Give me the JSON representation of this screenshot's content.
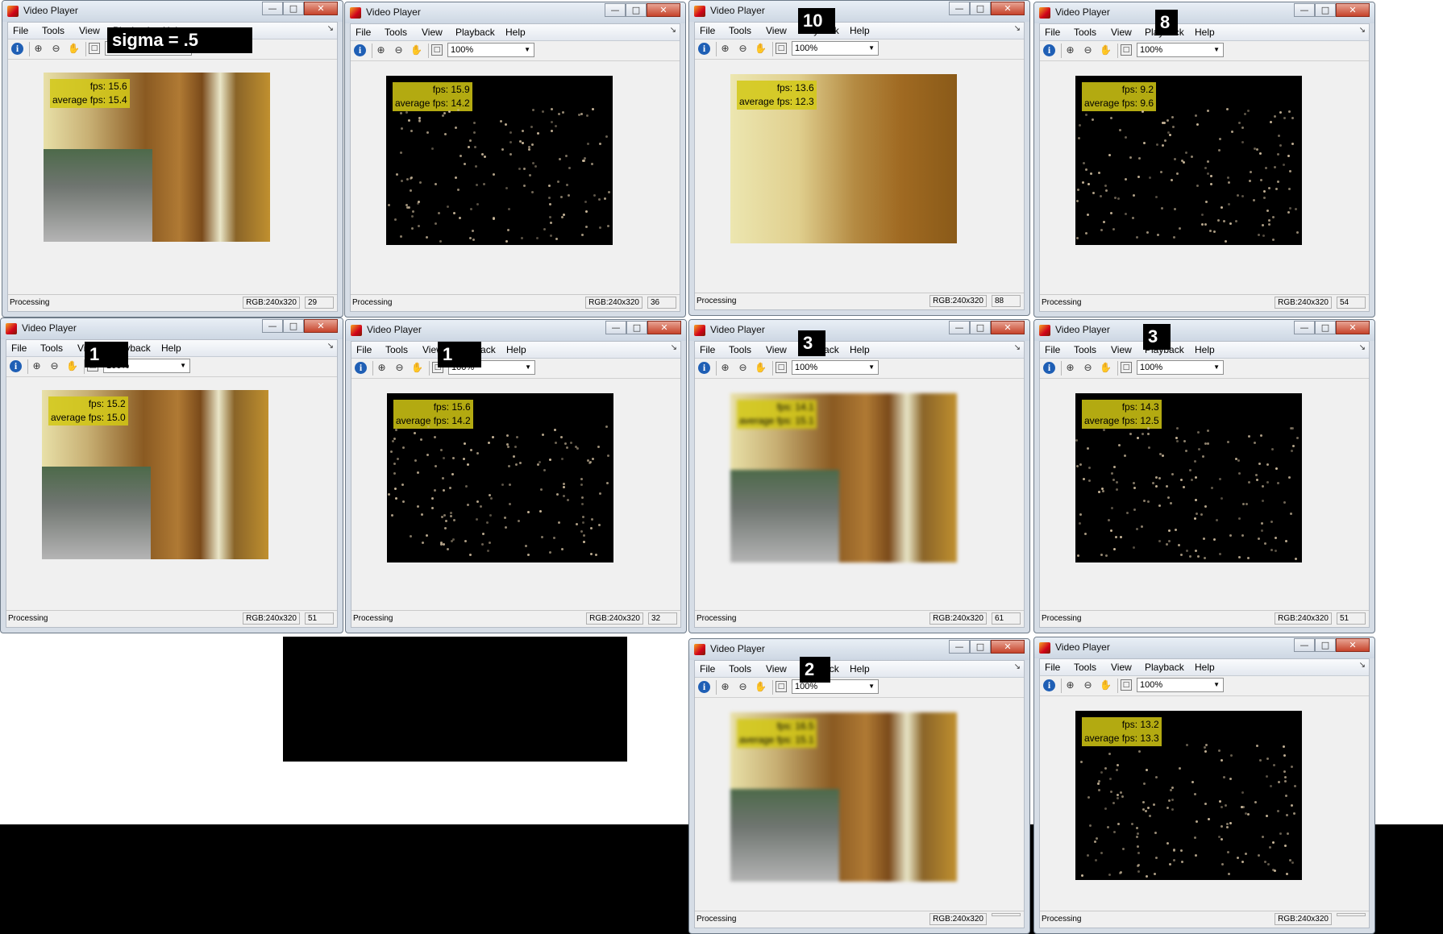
{
  "window": {
    "title": "Video Player",
    "menu": {
      "file": "File",
      "tools": "Tools",
      "view": "View",
      "playback": "Playback",
      "help": "Help"
    },
    "zoom": "100%",
    "status": "Processing",
    "resolution": "RGB:240x320"
  },
  "labels": {
    "sigma": "sigma = .5",
    "ten": "10",
    "eight": "8",
    "one_a": "1",
    "one_b": "1",
    "three_a": "3",
    "three_b": "3",
    "two": "2"
  },
  "players": [
    {
      "fps": "fps: 15.6",
      "avg": "average fps: 15.4",
      "frame": "29"
    },
    {
      "fps": "fps: 15.9",
      "avg": "average fps: 14.2",
      "frame": "36"
    },
    {
      "fps": "fps: 13.6",
      "avg": "average fps: 12.3",
      "frame": "88"
    },
    {
      "fps": "fps: 9.2",
      "avg": "average fps: 9.6",
      "frame": "54"
    },
    {
      "fps": "fps: 15.2",
      "avg": "average fps: 15.0",
      "frame": "51"
    },
    {
      "fps": "fps: 15.6",
      "avg": "average fps: 14.2",
      "frame": "32"
    },
    {
      "fps": "fps: 14.1",
      "avg": "average fps: 15.1",
      "frame": "61"
    },
    {
      "fps": "fps: 14.3",
      "avg": "average fps: 12.5",
      "frame": "51"
    },
    {
      "fps": "fps: 16.5",
      "avg": "average fps: 15.1",
      "frame": ""
    },
    {
      "fps": "fps: 13.2",
      "avg": "average fps: 13.3",
      "frame": ""
    }
  ]
}
